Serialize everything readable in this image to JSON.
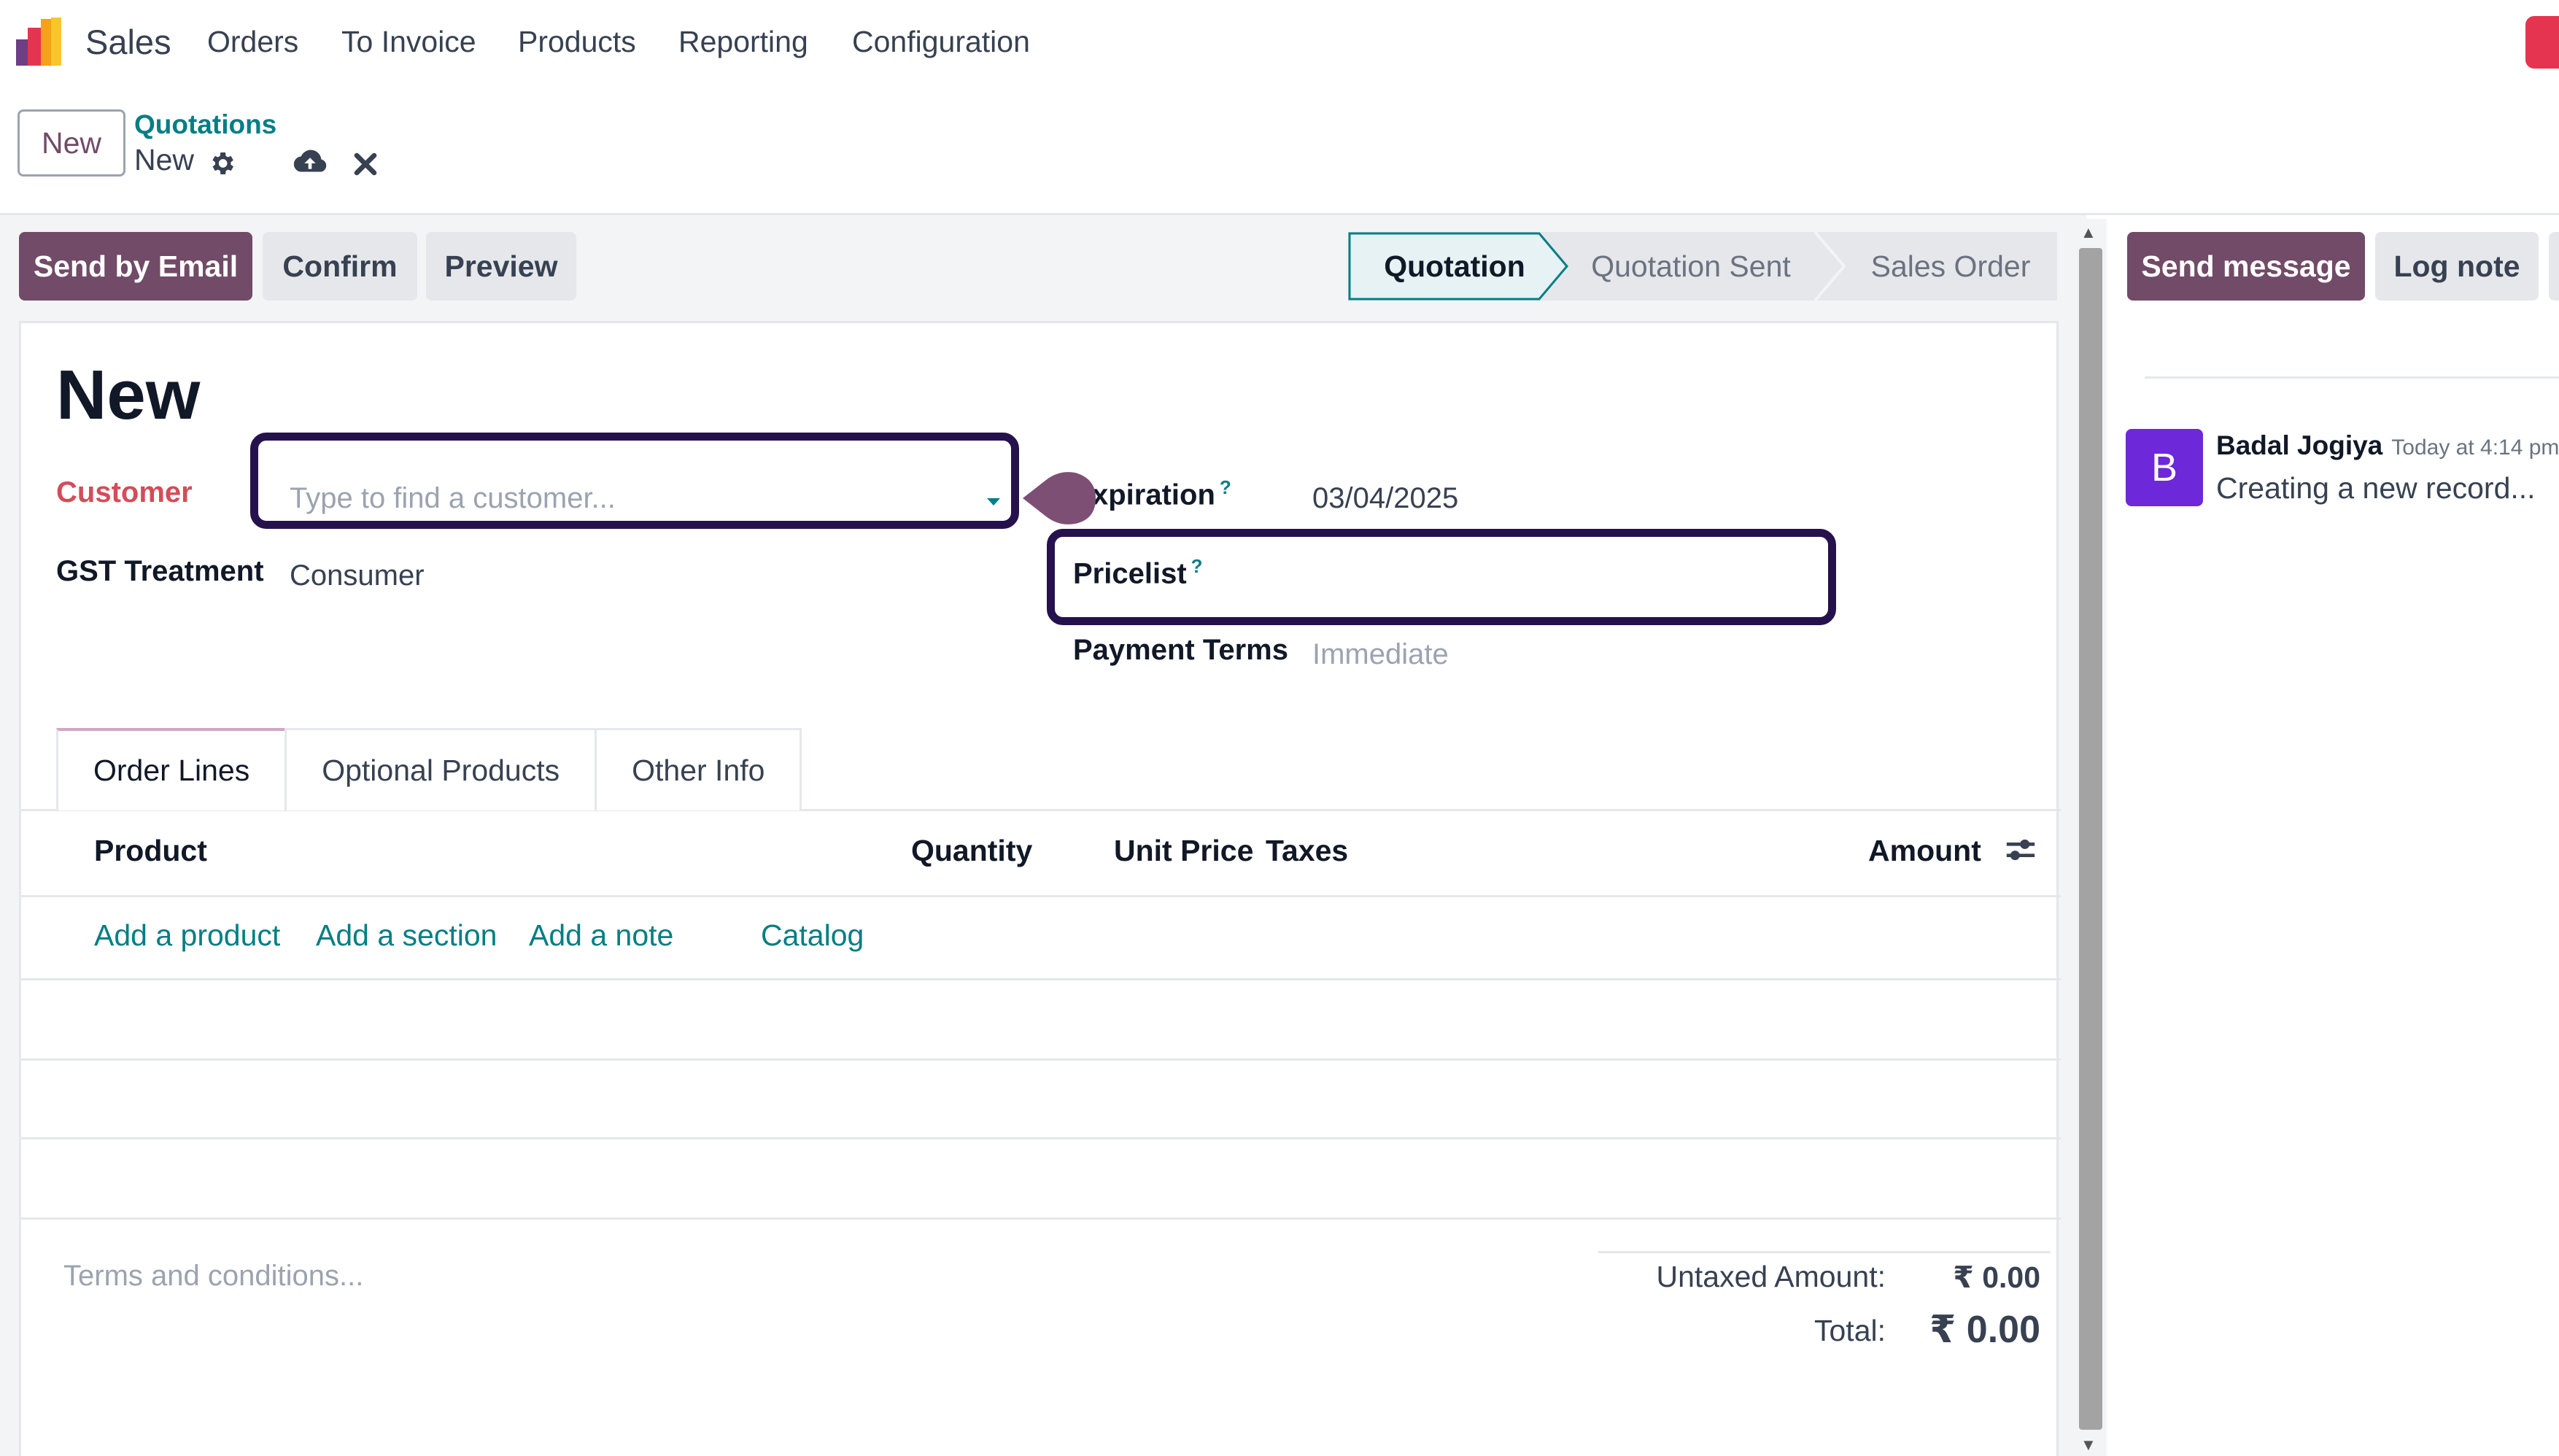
{
  "navbar": {
    "app_name": "Sales",
    "menu": [
      "Orders",
      "To Invoice",
      "Products",
      "Reporting",
      "Configuration"
    ]
  },
  "control_panel": {
    "new_button": "New",
    "breadcrumb_parent": "Quotations",
    "breadcrumb_current": "New"
  },
  "actions": {
    "send_by_email": "Send by Email",
    "confirm": "Confirm",
    "preview": "Preview"
  },
  "statusbar": {
    "stages": [
      "Quotation",
      "Quotation Sent",
      "Sales Order"
    ],
    "active": "Quotation"
  },
  "form": {
    "title": "New",
    "customer_label": "Customer",
    "customer_placeholder": "Type to find a customer...",
    "gst_label": "GST Treatment",
    "gst_value": "Consumer",
    "expiration_label": "xpiration",
    "expiration_value": "03/04/2025",
    "pricelist_label": "Pricelist",
    "payment_terms_label": "Payment Terms",
    "payment_terms_placeholder": "Immediate",
    "help_mark": "?"
  },
  "tabs": [
    "Order Lines",
    "Optional Products",
    "Other Info"
  ],
  "order_lines": {
    "columns": {
      "product": "Product",
      "quantity": "Quantity",
      "unit_price": "Unit Price",
      "taxes": "Taxes",
      "amount": "Amount"
    },
    "links": {
      "add_product": "Add a product",
      "add_section": "Add a section",
      "add_note": "Add a note",
      "catalog": "Catalog"
    }
  },
  "footer": {
    "terms_placeholder": "Terms and conditions...",
    "untaxed_label": "Untaxed Amount:",
    "untaxed_value": "₹ 0.00",
    "total_label": "Total:",
    "total_value": "₹ 0.00"
  },
  "chatter": {
    "send_message": "Send message",
    "log_note": "Log note",
    "message": {
      "avatar_initial": "B",
      "author": "Badal Jogiya",
      "time": "Today at 4:14 pm",
      "body": "Creating a new record..."
    }
  },
  "colors": {
    "primary": "#714b67",
    "link": "#017e84",
    "highlight": "#25124c",
    "required": "#d44c59",
    "avatar": "#6d28d9"
  }
}
